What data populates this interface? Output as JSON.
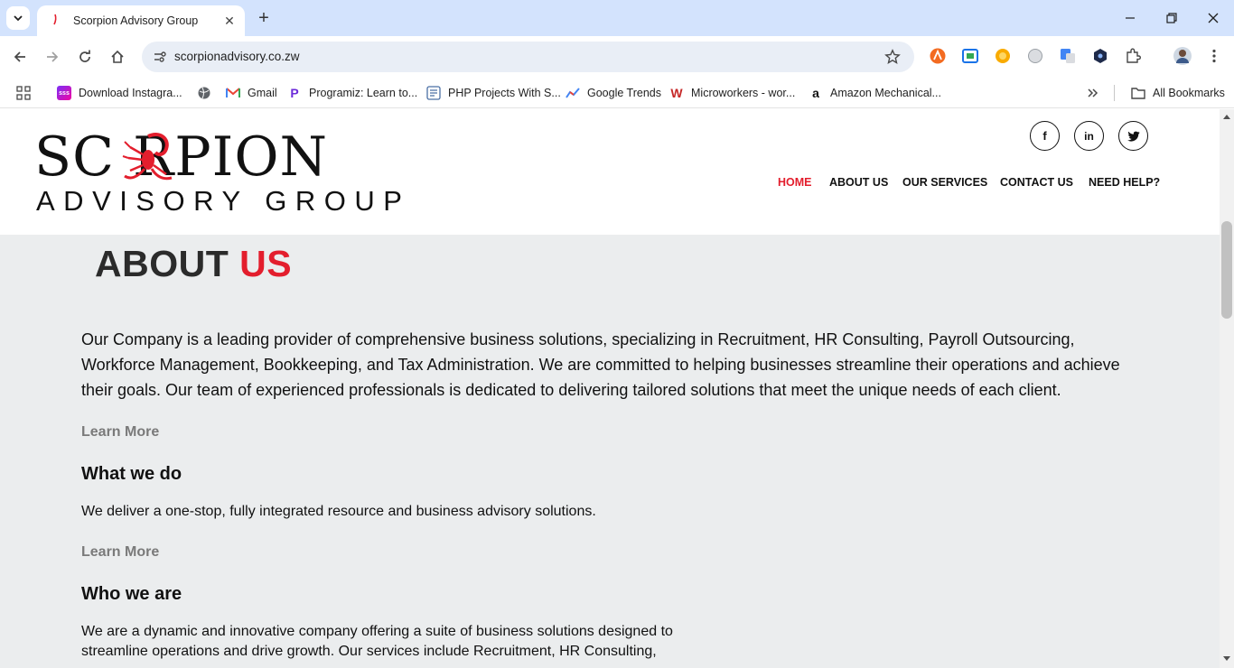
{
  "browser": {
    "tab_title": "Scorpion Advisory Group",
    "url": "scorpionadvisory.co.zw",
    "bookmarks": [
      "Download Instagra...",
      "Gmail",
      "Programiz: Learn to...",
      "PHP Projects With S...",
      "Google Trends",
      "Microworkers - wor...",
      "Amazon Mechanical..."
    ],
    "all_bookmarks": "All Bookmarks"
  },
  "site": {
    "logo_line1": "SC RPION",
    "logo_line2": "ADVISORY GROUP",
    "social": {
      "facebook": "f",
      "linkedin": "in",
      "twitter": "t"
    },
    "nav": {
      "home": "HOME",
      "about": "ABOUT US",
      "services": "OUR SERVICES",
      "contact": "CONTACT US",
      "help": "NEED HELP?"
    },
    "accent_color": "#e31e2d"
  },
  "about": {
    "heading_a": "ABOUT",
    "heading_b": "US",
    "intro": "Our Company is a leading provider of comprehensive business solutions, specializing in Recruitment, HR Consulting, Payroll Outsourcing, Workforce Management, Bookkeeping, and Tax Administration. We are committed to helping businesses streamline their operations and achieve their goals. Our team of experienced professionals is dedicated to delivering tailored solutions that meet the unique needs of each client.",
    "learn_more_1": "Learn More",
    "what_heading": "What we do",
    "what_text": "We deliver a one-stop, fully integrated resource and business advisory solutions.",
    "learn_more_2": "Learn More",
    "who_heading": "Who we are",
    "who_line1": "We are a dynamic and innovative company offering a suite of business solutions designed to",
    "who_line2": "streamline operations and drive growth. Our services include Recruitment, HR Consulting,"
  }
}
